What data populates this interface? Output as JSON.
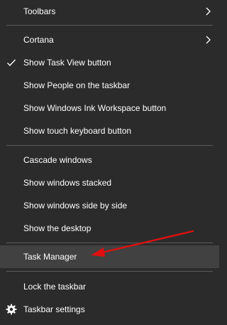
{
  "menu": {
    "toolbars": "Toolbars",
    "cortana": "Cortana",
    "show_task_view": "Show Task View button",
    "show_people": "Show People on the taskbar",
    "show_ink": "Show Windows Ink Workspace button",
    "show_touch_keyboard": "Show touch keyboard button",
    "cascade": "Cascade windows",
    "stacked": "Show windows stacked",
    "side_by_side": "Show windows side by side",
    "show_desktop": "Show the desktop",
    "task_manager": "Task Manager",
    "lock_taskbar": "Lock the taskbar",
    "taskbar_settings": "Taskbar settings"
  },
  "icons": {
    "submenu": "chevron-right-icon",
    "checked": "checkmark-icon",
    "settings": "gear-icon",
    "annotation": "red-arrow"
  },
  "colors": {
    "menu_bg": "#2b2b2b",
    "highlight_bg": "#414141",
    "text": "#ffffff",
    "separator": "#5a5a5a",
    "annotation": "#e01010"
  }
}
